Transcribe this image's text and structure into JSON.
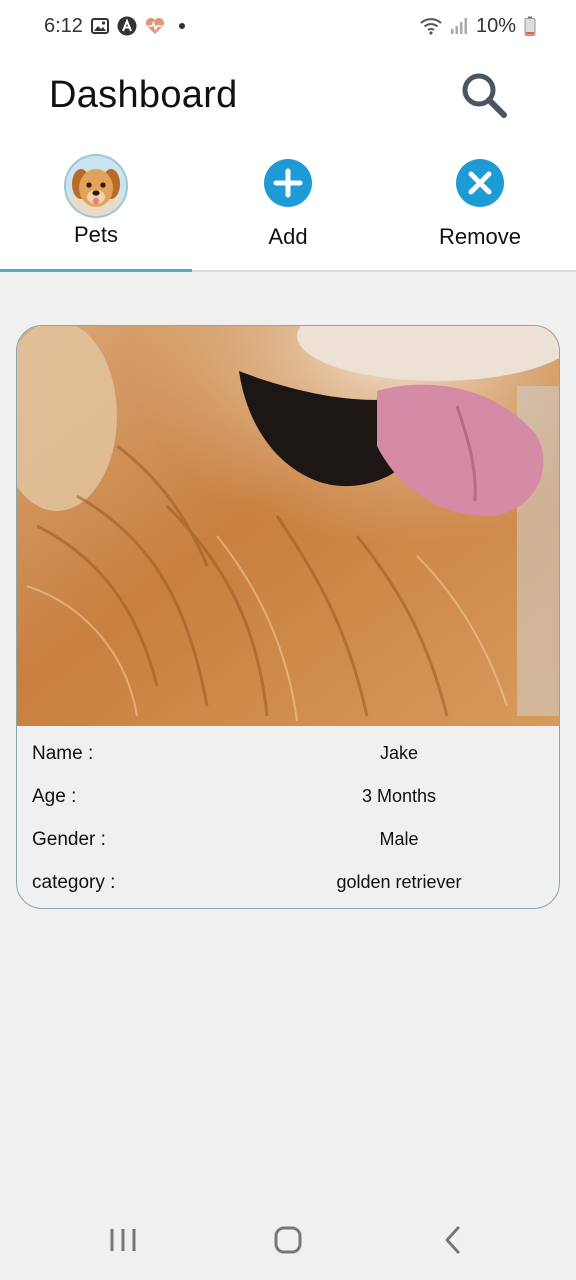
{
  "status_bar": {
    "time": "6:12",
    "left_icons": [
      "image-icon",
      "a-circle-icon",
      "heart-rate-icon"
    ],
    "right_icons": [
      "wifi-icon",
      "signal-icon",
      "battery-icon"
    ],
    "battery": "10%"
  },
  "header": {
    "title": "Dashboard",
    "search_icon": "search-icon"
  },
  "tabs": [
    {
      "label": "Pets",
      "icon": "pet-avatar",
      "active": true
    },
    {
      "label": "Add",
      "icon": "plus-circle-icon",
      "active": false
    },
    {
      "label": "Remove",
      "icon": "close-circle-icon",
      "active": false
    }
  ],
  "pet_card": {
    "fields": [
      {
        "label": "Name :",
        "value": "Jake"
      },
      {
        "label": "Age :",
        "value": "3 Months"
      },
      {
        "label": "Gender :",
        "value": "Male"
      },
      {
        "label": "category :",
        "value": "golden retriever"
      }
    ]
  },
  "nav_bar": {
    "buttons": [
      "recent-apps-icon",
      "home-icon",
      "back-icon"
    ]
  },
  "colors": {
    "accent": "#1e9ad6",
    "tab_indicator": "#5aa6cf",
    "background": "#f0f0f0",
    "header_bg": "#ffffff"
  }
}
